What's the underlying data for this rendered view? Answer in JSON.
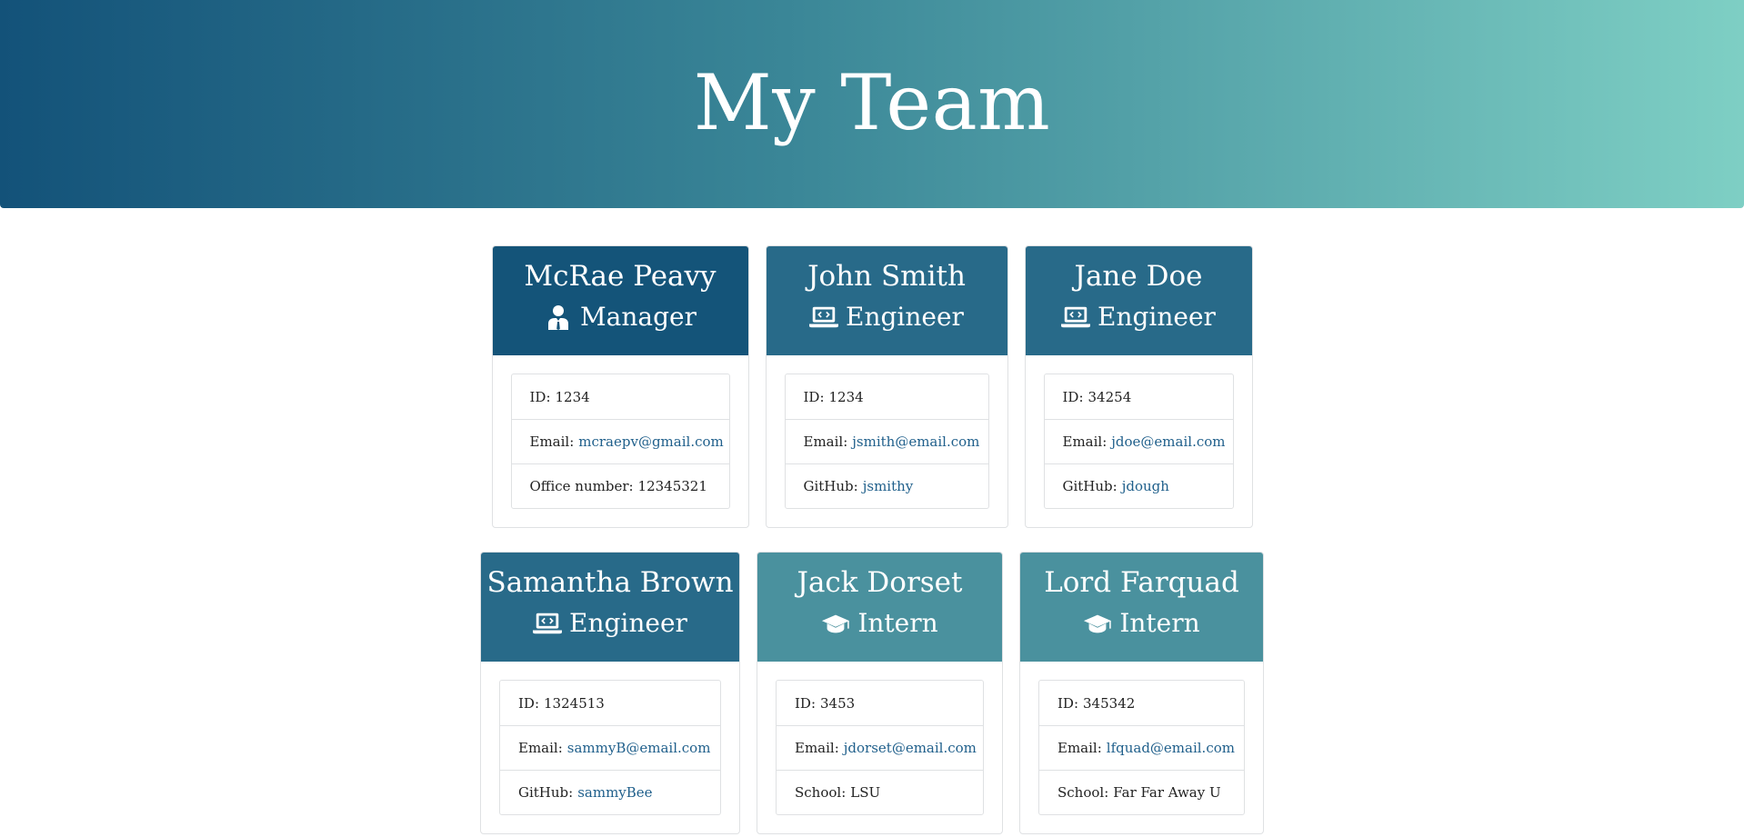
{
  "header": {
    "title": "My Team"
  },
  "team": [
    {
      "name": "McRae Peavy",
      "role": "Manager",
      "role_icon": "user-tie-icon",
      "id_label": "ID:",
      "id": "1234",
      "email_label": "Email:",
      "email": "mcraepv@gmail.com",
      "extra_label": "Office number:",
      "extra": "12345321"
    },
    {
      "name": "John Smith",
      "role": "Engineer",
      "role_icon": "laptop-code-icon",
      "id_label": "ID:",
      "id": "1234",
      "email_label": "Email:",
      "email": "jsmith@email.com",
      "extra_label": "GitHub:",
      "extra": "jsmithy"
    },
    {
      "name": "Jane Doe",
      "role": "Engineer",
      "role_icon": "laptop-code-icon",
      "id_label": "ID:",
      "id": "34254",
      "email_label": "Email:",
      "email": "jdoe@email.com",
      "extra_label": "GitHub:",
      "extra": "jdough"
    },
    {
      "name": "Samantha Brown",
      "role": "Engineer",
      "role_icon": "laptop-code-icon",
      "id_label": "ID:",
      "id": "1324513",
      "email_label": "Email:",
      "email": "sammyB@email.com",
      "extra_label": "GitHub:",
      "extra": "sammyBee"
    },
    {
      "name": "Jack Dorset",
      "role": "Intern",
      "role_icon": "graduation-cap-icon",
      "id_label": "ID:",
      "id": "3453",
      "email_label": "Email:",
      "email": "jdorset@email.com",
      "extra_label": "School:",
      "extra": "LSU"
    },
    {
      "name": "Lord Farquad",
      "role": "Intern",
      "role_icon": "graduation-cap-icon",
      "id_label": "ID:",
      "id": "345342",
      "email_label": "Email:",
      "email": "lfquad@email.com",
      "extra_label": "School:",
      "extra": "Far Far Away U"
    }
  ],
  "colors": {
    "manager_header": "#145479",
    "engineer_header": "#286a89",
    "intern_header": "#4a919e",
    "link": "#1f5f8b",
    "hero_gradient_start": "#135279",
    "hero_gradient_end": "#7ecfc4"
  }
}
